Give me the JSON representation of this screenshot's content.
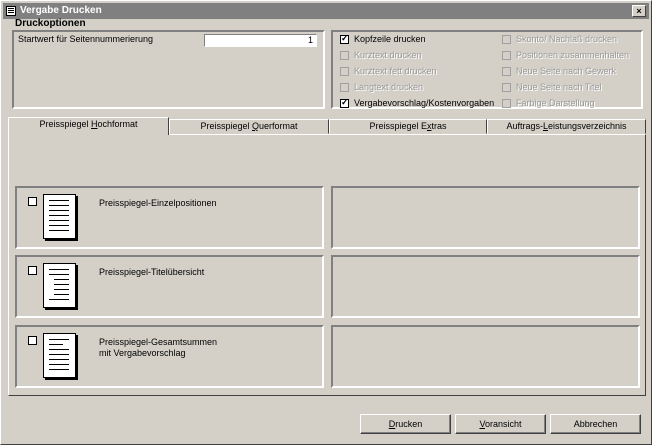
{
  "window": {
    "title": "Vergabe Drucken",
    "close_label": "×"
  },
  "druckoptionen": {
    "label": "Druckoptionen",
    "startwert_label": "Startwert für Seitennummerierung",
    "startwert_value": "1",
    "checks_left": [
      {
        "label": "Kopfzeile drucken",
        "checked": true,
        "enabled": true
      },
      {
        "label": "Kurztext drucken",
        "checked": false,
        "enabled": false
      },
      {
        "label": "Kurztext fett drucken",
        "checked": false,
        "enabled": false
      },
      {
        "label": "Langtext drucken",
        "checked": false,
        "enabled": false
      },
      {
        "label": "Vergabevorschlag/Kostenvorgaben",
        "checked": true,
        "enabled": true
      }
    ],
    "checks_right": [
      {
        "label": "Skonto/ Nachlaß drucken",
        "checked": false,
        "enabled": false
      },
      {
        "label": "Positionen zusammenhalten",
        "checked": false,
        "enabled": false
      },
      {
        "label": "Neue Seite nach Gewerk",
        "checked": false,
        "enabled": false
      },
      {
        "label": "Neue Seite nach Titel",
        "checked": false,
        "enabled": false
      },
      {
        "label": "Farbige Darstellung",
        "checked": false,
        "enabled": false
      }
    ]
  },
  "tabs": [
    {
      "pre": "Preisspiegel ",
      "u": "H",
      "post": "ochformat",
      "active": true
    },
    {
      "pre": "Preisspiegel ",
      "u": "Q",
      "post": "uerformat",
      "active": false
    },
    {
      "pre": "Preisspiegel E",
      "u": "x",
      "post": "tras",
      "active": false
    },
    {
      "pre": "Auftrags-",
      "u": "L",
      "post": "eistungsverzeichnis",
      "active": false
    }
  ],
  "reports": [
    {
      "line1": "Preisspiegel-Einzelpositionen",
      "line2": ""
    },
    {
      "line1": "Preisspiegel-Titelübersicht",
      "line2": ""
    },
    {
      "line1": "Preisspiegel-Gesamtsummen",
      "line2": "mit Vergabevorschlag"
    }
  ],
  "buttons": {
    "drucken": {
      "u": "D",
      "rest": "rucken"
    },
    "voransicht": {
      "u": "V",
      "rest": "oransicht"
    },
    "abbrechen": {
      "label": "Abbrechen"
    }
  },
  "icons": {
    "app": "print-dialog-icon",
    "document": "document-page-icon"
  }
}
